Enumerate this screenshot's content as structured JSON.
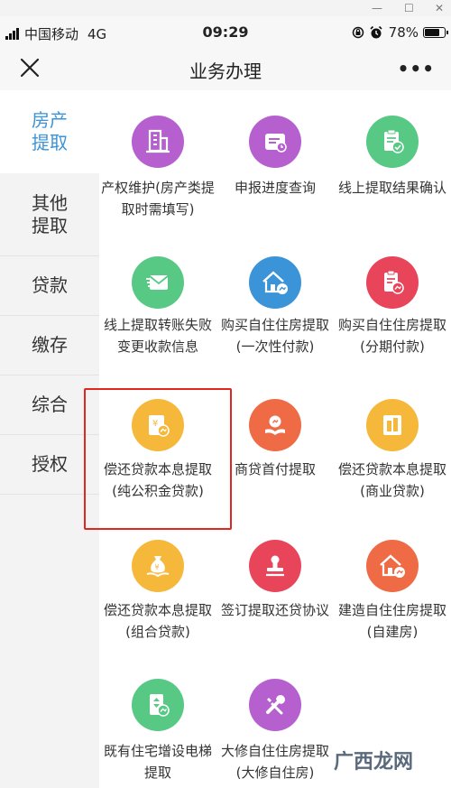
{
  "status_bar": {
    "carrier": "中国移动",
    "network": "4G",
    "time": "09:29",
    "battery": "78%",
    "battery_level": 0.78
  },
  "nav": {
    "title": "业务办理",
    "more": "•••"
  },
  "sidebar": {
    "items": [
      {
        "label": "房产\n提取",
        "active": true
      },
      {
        "label": "其他\n提取",
        "active": false
      },
      {
        "label": "贷款",
        "active": false
      },
      {
        "label": "缴存",
        "active": false
      },
      {
        "label": "综合",
        "active": false
      },
      {
        "label": "授权",
        "active": false
      }
    ]
  },
  "tiles": [
    {
      "label": "产权维护(房产类提取时需填写)",
      "icon": "building-icon",
      "color": "#b660cf"
    },
    {
      "label": "申报进度查询",
      "icon": "progress-query-icon",
      "color": "#b660cf"
    },
    {
      "label": "线上提取结果确认",
      "icon": "result-confirm-icon",
      "color": "#58c985"
    },
    {
      "label": "线上提取转账失败变更收款信息",
      "icon": "envelope-icon",
      "color": "#58c985"
    },
    {
      "label": "购买自住住房提取(一次性付款)",
      "icon": "house-coin-icon",
      "color": "#3b93d8"
    },
    {
      "label": "购买自住住房提取(分期付款)",
      "icon": "document-coin-icon",
      "color": "#e8455a"
    },
    {
      "label": "偿还贷款本息提取(纯公积金贷款)",
      "icon": "yuan-coin-icon",
      "color": "#f5b83a"
    },
    {
      "label": "商贷首付提取",
      "icon": "hand-coin-icon",
      "color": "#ef6b46"
    },
    {
      "label": "偿还贷款本息提取(商业贷款)",
      "icon": "building-doc-icon",
      "color": "#f5b83a"
    },
    {
      "label": "偿还贷款本息提取(组合贷款)",
      "icon": "money-bag-icon",
      "color": "#f5b83a"
    },
    {
      "label": "签订提取还贷协议",
      "icon": "stamp-icon",
      "color": "#e8455a"
    },
    {
      "label": "建造自住住房提取(自建房)",
      "icon": "house-coin-icon",
      "color": "#ef6b46"
    },
    {
      "label": "既有住宅增设电梯提取",
      "icon": "elevator-icon",
      "color": "#58c985"
    },
    {
      "label": "大修自住住房提取(大修自住房)",
      "icon": "wrench-icon",
      "color": "#b660cf"
    }
  ],
  "watermark": "广西龙网"
}
